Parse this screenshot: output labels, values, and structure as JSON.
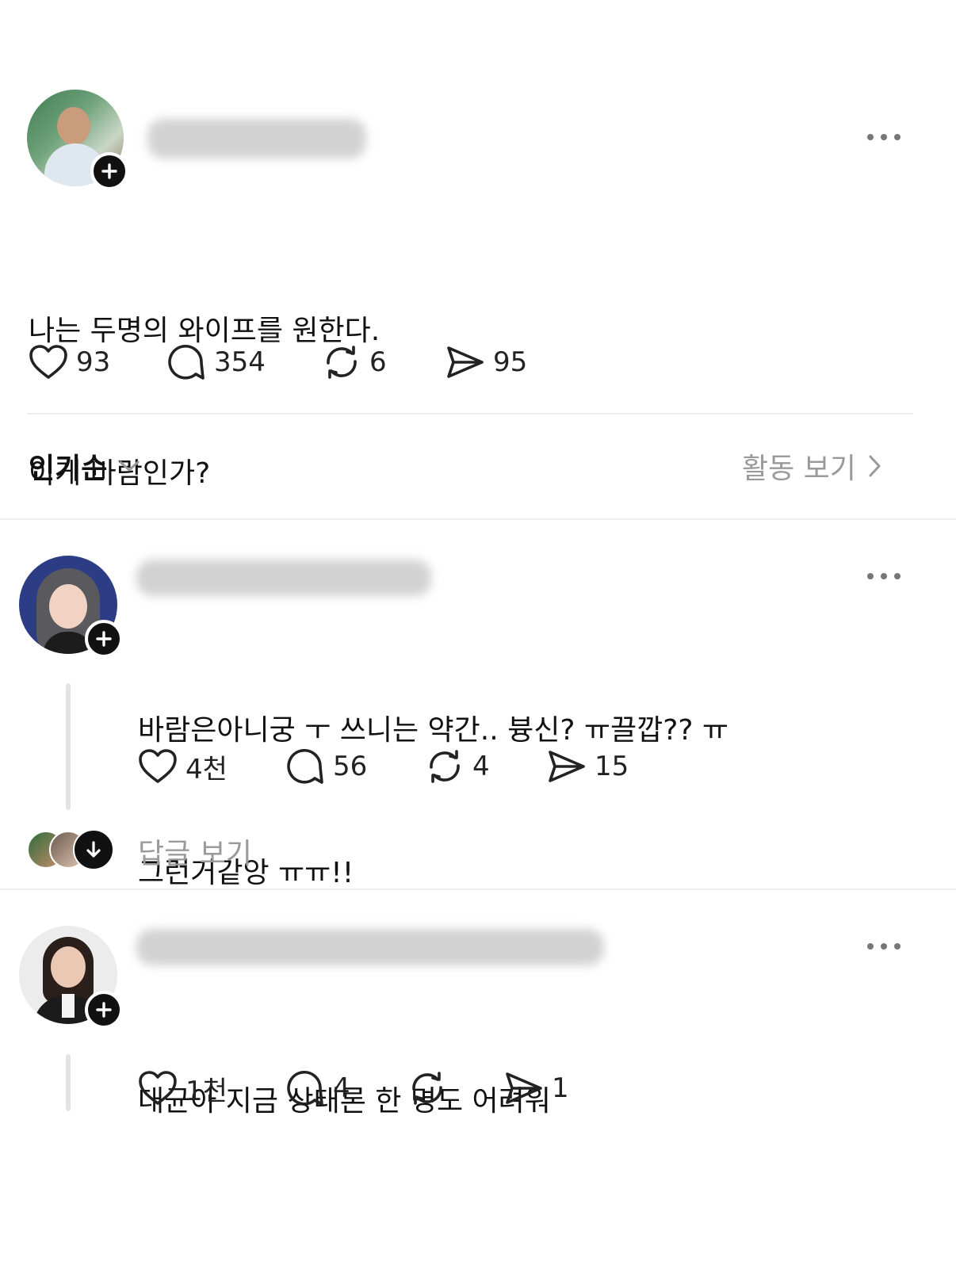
{
  "post": {
    "text_line1": "나는 두명의 와이프를 원한다.",
    "text_line2": "이게 바람인가?",
    "likes": "93",
    "comments": "354",
    "reposts": "6",
    "shares": "95"
  },
  "sort_bar": {
    "sort_label": "인기순",
    "activity_label": "활동 보기"
  },
  "replies": [
    {
      "text_line1": "바람은아니궁 ㅜ 쓰니는 약간.. 븅신? ㅠ끌깝?? ㅠ",
      "text_line2": "그런거같앙 ㅠㅠ!!",
      "likes": "4천",
      "comments": "56",
      "reposts": "4",
      "shares": "15",
      "view_replies_label": "답글 보기"
    },
    {
      "text_line1": "대균아 지금 상태론 한 명도 어려워",
      "likes": "1천",
      "comments": "4",
      "reposts": "",
      "shares": "1"
    }
  ],
  "colors": {
    "text": "#111111",
    "muted": "#9a9a9a",
    "divider": "#eeeeee",
    "icon": "#222222"
  }
}
